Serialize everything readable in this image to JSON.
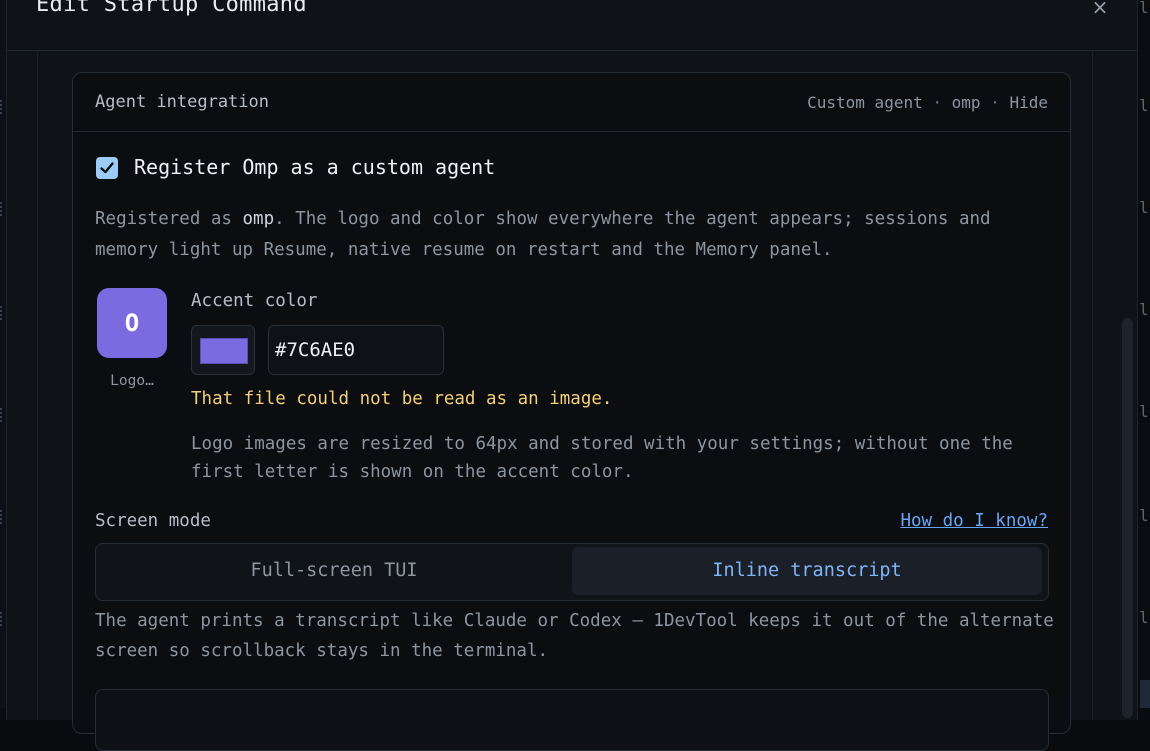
{
  "modal": {
    "title": "Edit Startup Command",
    "close_glyph": "×"
  },
  "background": {
    "right_gutter_glyph": "l"
  },
  "card": {
    "title": "Agent integration",
    "meta_kind": "Custom agent",
    "meta_sep": "·",
    "meta_name": "omp",
    "meta_hide": "Hide"
  },
  "register": {
    "checked": true,
    "label": "Register Omp as a custom agent",
    "desc_prefix": "Registered as ",
    "desc_code": "omp",
    "desc_suffix": ". The logo and color show everywhere the agent appears; sessions and memory light up Resume, native resume on restart and the Memory panel."
  },
  "logo": {
    "letter": "O",
    "caption": "Logo…",
    "icon": "logo-placeholder"
  },
  "accent": {
    "label": "Accent color",
    "value": "#7C6AE0",
    "color": "#7c6ae0"
  },
  "error": "That file could not be read as an image.",
  "hint": "Logo images are resized to 64px and stored with your settings; without one the first letter is shown on the accent color.",
  "screen_mode": {
    "label": "Screen mode",
    "help_link": "How do I know?",
    "options": [
      "Full-screen TUI",
      "Inline transcript"
    ],
    "selected": "Inline transcript",
    "description": "The agent prints a transcript like Claude or Codex — 1DevTool keeps it out of the alternate screen so scrollback stays in the terminal."
  },
  "colors": {
    "accent": "#7c6ae0",
    "link": "#6aa6f5",
    "warning": "#f3cf7a",
    "checkbox": "#9ccbf7"
  }
}
